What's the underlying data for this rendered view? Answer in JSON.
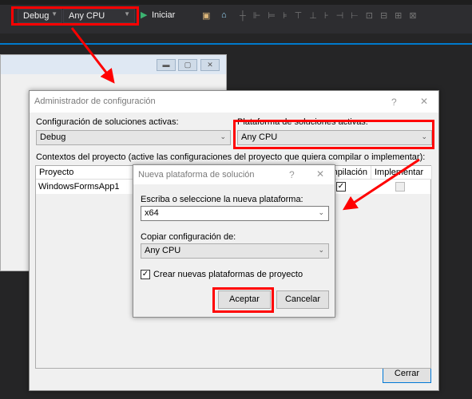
{
  "toolbar": {
    "config": "Debug",
    "platform": "Any CPU",
    "start_label": "Iniciar"
  },
  "config_manager": {
    "title": "Administrador de configuración",
    "help": "?",
    "close": "✕",
    "active_config_label": "Configuración de soluciones activas:",
    "active_config_value": "Debug",
    "active_platform_label": "Plataforma de soluciones activas:",
    "active_platform_value": "Any CPU",
    "contexts_label": "Contextos del proyecto (active las configuraciones del proyecto que quiera compilar o implementar):",
    "columns": [
      "Proyecto",
      "Compilación",
      "Implementar"
    ],
    "rows": [
      {
        "project": "WindowsFormsApp1",
        "build": true,
        "deploy": false
      }
    ],
    "close_button": "Cerrar"
  },
  "new_platform": {
    "title": "Nueva plataforma de solución",
    "help": "?",
    "close": "✕",
    "platform_label": "Escriba o seleccione la nueva plataforma:",
    "platform_value": "x64",
    "copy_label": "Copiar configuración de:",
    "copy_value": "Any CPU",
    "create_label": "Crear nuevas plataformas de proyecto",
    "create_checked": true,
    "accept": "Aceptar",
    "cancel": "Cancelar"
  },
  "colors": {
    "highlight": "#ff0000",
    "accent": "#007acc"
  }
}
